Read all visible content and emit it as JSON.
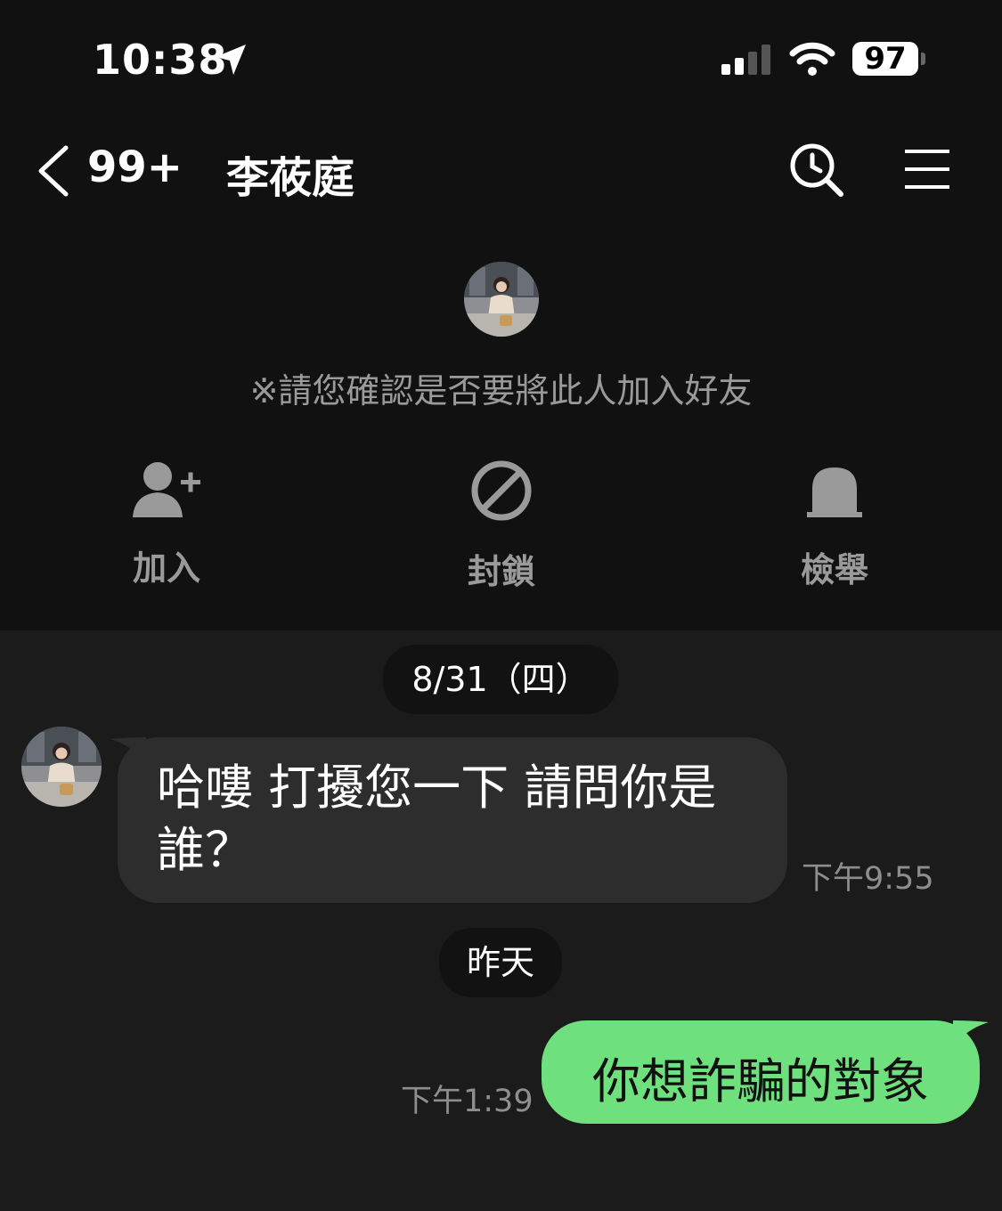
{
  "status_bar": {
    "time": "10:38",
    "battery": "97"
  },
  "header": {
    "unread_count": "99+",
    "contact_name": "李莜庭"
  },
  "notice": "※請您確認是否要將此人加入好友",
  "actions": [
    {
      "label": "加入",
      "icon": "add-friend-icon"
    },
    {
      "label": "封鎖",
      "icon": "block-icon"
    },
    {
      "label": "檢舉",
      "icon": "report-icon"
    }
  ],
  "messages": [
    {
      "date": "8/31（四）",
      "from": "contact",
      "text": "哈嘍 打擾您一下 請問你是誰？",
      "time": "下午9:55"
    },
    {
      "date": "昨天",
      "from": "me",
      "text": "你想詐騙的對象",
      "time": "下午1:39"
    }
  ],
  "colors": {
    "outgoing_bubble": "#6ee07d",
    "incoming_bubble": "#2d2d2d",
    "background": "#1b1b1b",
    "header_bg": "#111111"
  }
}
